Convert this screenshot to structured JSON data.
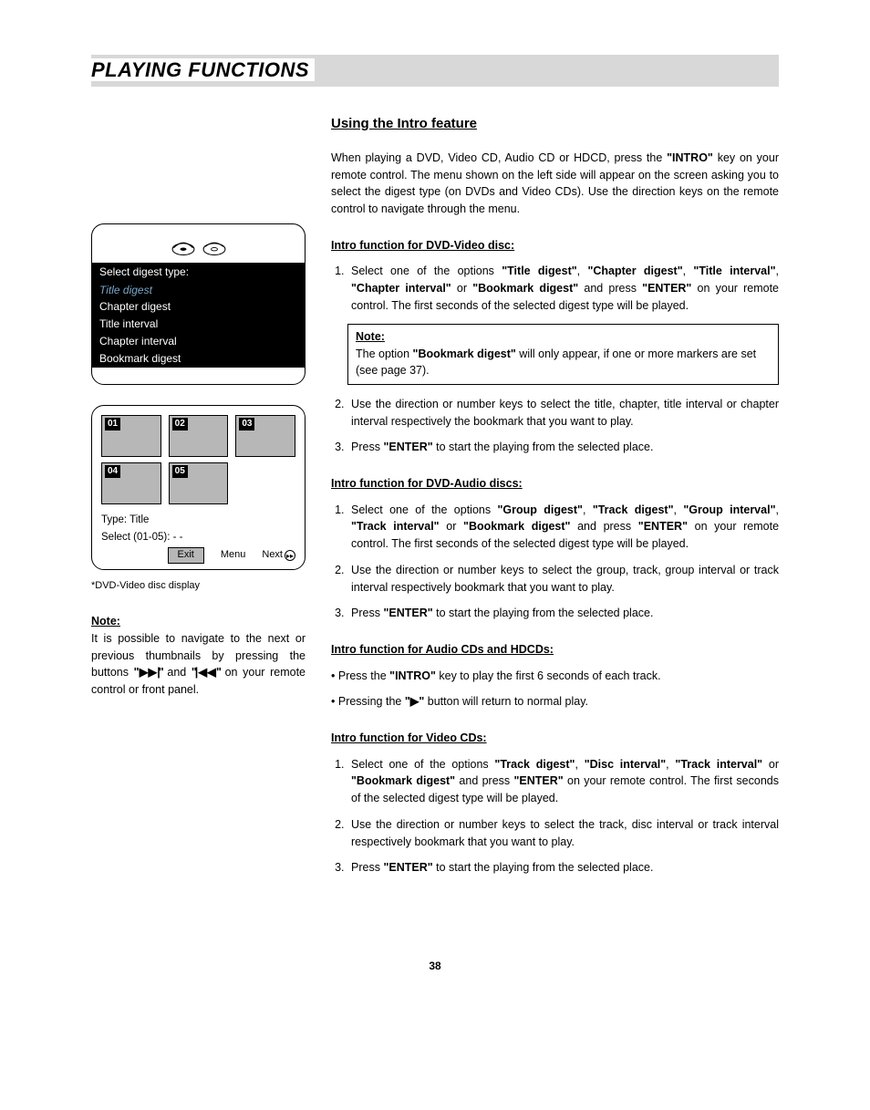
{
  "header": {
    "title": "PLAYING FUNCTIONS"
  },
  "left": {
    "menu_header": "Select digest type:",
    "menu_items": [
      "Title digest",
      "Chapter digest",
      "Title interval",
      "Chapter interval",
      "Bookmark digest"
    ],
    "thumbs": [
      "01",
      "02",
      "03",
      "04",
      "05"
    ],
    "type_line1": "Type: Title",
    "type_line2": "Select (01-05): - -",
    "btn_exit": "Exit",
    "btn_menu": "Menu",
    "btn_next": "Next",
    "caption": "*DVD-Video disc display",
    "note_label": "Note:",
    "note_body_a": "It is possible to navigate to the next or previous thumbnails by pressing the buttons ",
    "note_body_b": " and ",
    "note_body_c": " on your remote control or front panel.",
    "skip_fwd": "\"▶▶|\"",
    "skip_back": "\"|◀◀\""
  },
  "right": {
    "h2": "Using the Intro feature",
    "intro_a": "When playing a DVD, Video CD, Audio CD or HDCD, press the ",
    "intro_key": "\"INTRO\"",
    "intro_b": " key on your remote control. The menu shown on the left side will appear on the screen asking you to select the digest type (on DVDs and Video CDs). Use the direction keys on the remote control to navigate through the menu.",
    "dvdv_head": "Intro function for DVD-Video disc:",
    "dvdv_1a": "Select one of the options ",
    "dvdv_1_opts": [
      "\"Title digest\"",
      "\"Chapter digest\"",
      "\"Title interval\"",
      "\"Chapter interval\"",
      "\"Bookmark digest\""
    ],
    "dvdv_1b": " and press ",
    "enter": "\"ENTER\"",
    "dvdv_1c": " on your remote control. The first seconds of the selected digest type will be played.",
    "note_box_label": "Note:",
    "note_box_a": "The option ",
    "note_box_opt": "\"Bookmark digest\"",
    "note_box_b": " will only appear, if one or more markers are set (see page 37).",
    "dvdv_2": "Use the direction or number keys to select the title, chapter, title interval or chapter interval respectively the bookmark that you want to play.",
    "dvdv_3a": "Press ",
    "dvdv_3b": " to start the playing from the selected place.",
    "dvda_head": "Intro function for DVD-Audio discs:",
    "dvda_1a": "Select one of the options ",
    "dvda_1_opts": [
      "\"Group digest\"",
      "\"Track digest\"",
      "\"Group interval\"",
      "\"Track interval\"",
      "\"Bookmark digest\""
    ],
    "dvda_1b": " and press ",
    "dvda_1c": " on your remote control. The first seconds of the selected digest type will be played.",
    "dvda_2": "Use the direction or number keys to select the group, track, group interval or track interval respectively bookmark that you want to play.",
    "dvda_3a": "Press ",
    "dvda_3b": " to start the playing from the selected place.",
    "cd_head": "Intro function for Audio CDs and HDCDs:",
    "cd_1a": "Press the ",
    "cd_1b": " key to play the first 6 seconds of each track.",
    "cd_2a": "Pressing the ",
    "cd_play": "\"▶\"",
    "cd_2b": " button will return to normal play.",
    "vcd_head": "Intro function for  Video CDs:",
    "vcd_1a": "Select one of the options ",
    "vcd_1_opts": [
      "\"Track digest\"",
      "\"Disc interval\"",
      "\"Track interval\"",
      "\"Bookmark digest\""
    ],
    "vcd_1b": " and press ",
    "vcd_1c": " on your remote control. The first seconds of the selected digest type will be played.",
    "vcd_2": "Use the direction or number keys to select the track, disc interval or track interval respectively bookmark that you want to play.",
    "vcd_3a": "Press ",
    "vcd_3b": " to start the playing from the selected place."
  },
  "page_number": "38"
}
